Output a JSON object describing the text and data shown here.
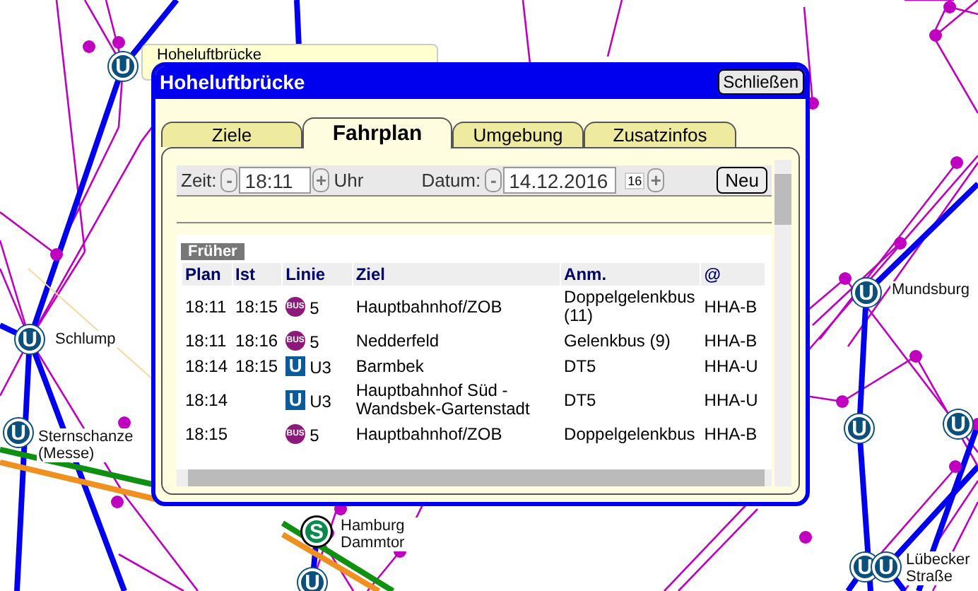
{
  "map": {
    "tooltip": "Hoheluftbrücke",
    "stations": [
      {
        "kind": "u",
        "badge": "U"
      },
      {
        "kind": "u",
        "badge": "U",
        "name": "Schlump"
      },
      {
        "kind": "u",
        "badge": "U",
        "name": "Sternschanze (Messe)"
      },
      {
        "kind": "s",
        "badge": "S",
        "name": "Hamburg Dammtor"
      },
      {
        "kind": "u",
        "badge": "U"
      },
      {
        "kind": "u",
        "badge": "U",
        "name": "Mundsburg"
      },
      {
        "kind": "u",
        "badge": "U"
      },
      {
        "kind": "u",
        "badge": "U"
      },
      {
        "kind": "u",
        "badge": "U"
      },
      {
        "kind": "u",
        "badge": "U",
        "name": "Lübecker Straße"
      }
    ]
  },
  "dialog": {
    "title": "Hoheluftbrücke",
    "close_button": "Schließen",
    "tabs": [
      {
        "label": "Ziele",
        "selected": false
      },
      {
        "label": "Fahrplan",
        "selected": true
      },
      {
        "label": "Umgebung",
        "selected": false
      },
      {
        "label": "Zusatzinfos",
        "selected": false
      }
    ],
    "time": {
      "label": "Zeit:",
      "minus": "-",
      "value": "18:11",
      "plus": "+",
      "unit": "Uhr"
    },
    "date": {
      "label": "Datum:",
      "minus": "-",
      "value": "14.12.2016",
      "calendar": "16",
      "plus": "+"
    },
    "new_button": "Neu",
    "earlier_button": "Früher",
    "table": {
      "columns": [
        "Plan",
        "Ist",
        "Linie",
        "Ziel",
        "Anm.",
        "@"
      ],
      "rows": [
        {
          "plan": "18:11",
          "ist": "18:15",
          "mode": {
            "kind": "bus",
            "badge": "BUS"
          },
          "line": "5",
          "ziel": "Hauptbahnhof/ZOB",
          "anm": "Doppelgelenkbus (11)",
          "operator": "HHA-B"
        },
        {
          "plan": "18:11",
          "ist": "18:16",
          "mode": {
            "kind": "bus",
            "badge": "BUS"
          },
          "line": "5",
          "ziel": "Nedderfeld",
          "anm": "Gelenkbus (9)",
          "operator": "HHA-B"
        },
        {
          "plan": "18:14",
          "ist": "18:15",
          "mode": {
            "kind": "u",
            "badge": "U"
          },
          "line": "U3",
          "ziel": "Barmbek",
          "anm": "DT5",
          "operator": "HHA-U"
        },
        {
          "plan": "18:14",
          "mode": {
            "kind": "u",
            "badge": "U"
          },
          "line": "U3",
          "ziel": "Hauptbahnhof Süd - Wandsbek-Gartenstadt",
          "anm": "DT5",
          "operator": "HHA-U"
        },
        {
          "plan": "18:15",
          "mode": {
            "kind": "bus",
            "badge": "BUS"
          },
          "line": "5",
          "ziel": "Hauptbahnhof/ZOB",
          "anm": "Doppelgelenkbus",
          "operator": "HHA-B"
        }
      ]
    }
  }
}
